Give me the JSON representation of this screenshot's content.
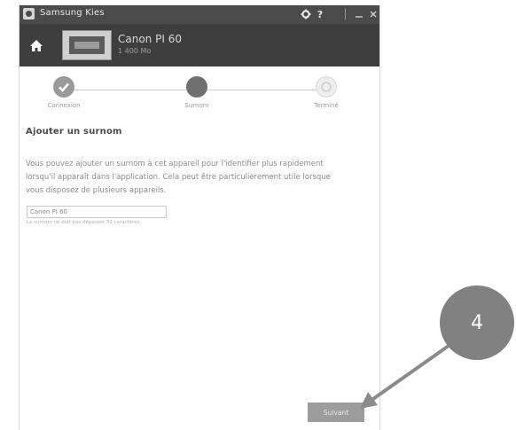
{
  "window": {
    "title": "Samsung Kies",
    "settings_icon": "gear-icon",
    "help_label": "?",
    "minimize_icon": "minimize-icon",
    "close_icon": "close-icon"
  },
  "header": {
    "home_icon": "home-icon",
    "device_name": "Canon PI 60",
    "device_subtitle": "1 400 Mo"
  },
  "steps": [
    {
      "label": "Connexion",
      "state": "done"
    },
    {
      "label": "Surnom",
      "state": "current"
    },
    {
      "label": "Terminé",
      "state": "pending"
    }
  ],
  "section": {
    "title": "Ajouter un surnom",
    "description": "Vous pouvez ajouter un surnom à cet appareil pour l'identifier plus rapidement lorsqu'il apparaît dans l'application. Cela peut être particulièrement utile lorsque vous disposez de plusieurs appareils."
  },
  "nickname": {
    "value": "Canon PI 60",
    "hint": "Le surnom ne doit pas dépasser 32 caractères."
  },
  "actions": {
    "next_label": "Suivant"
  },
  "callout": {
    "number": "4"
  },
  "colors": {
    "titlebar": "#4b4b4b",
    "header": "#3e3e3e",
    "step_done": "#9a9a9a",
    "step_current": "#6f6f6f",
    "button": "#9c9c9c",
    "callout": "#818181"
  }
}
